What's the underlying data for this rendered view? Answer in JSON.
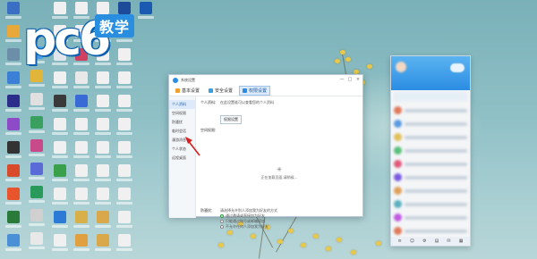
{
  "watermark": {
    "logo": "pc6",
    "badge": "教学"
  },
  "window": {
    "title": "系统设置",
    "controls": [
      "—",
      "□",
      "×"
    ],
    "tabs": [
      {
        "label": "基本设置",
        "icon": "basic-settings-icon",
        "active": false
      },
      {
        "label": "安全设置",
        "icon": "security-settings-icon",
        "active": false
      },
      {
        "label": "权限设置",
        "icon": "permission-settings-icon",
        "active": true
      }
    ],
    "sidebar": [
      {
        "label": "个人资料",
        "active": true
      },
      {
        "label": "空间权限",
        "active": false
      },
      {
        "label": "防骚扰",
        "active": false
      },
      {
        "label": "临时会话",
        "active": false
      },
      {
        "label": "漫游消息",
        "active": false
      },
      {
        "label": "个人状态",
        "active": false
      },
      {
        "label": "远程桌面",
        "active": false
      }
    ],
    "content": {
      "profile_label": "个人资料:",
      "profile_text": "在此设置谁可以查看您的个人资料",
      "profile_button": "权限设置",
      "space_label": "空间权限:",
      "loading_text": "正在加载页面,请稍候…",
      "anti_label": "防骚扰:",
      "anti_desc": "请选择允许别人添加我为好友的方式",
      "options": [
        {
          "label": "通过邀请或直接加为好友",
          "selected": true
        },
        {
          "label": "只能通过账号或邮箱添加",
          "selected": false
        },
        {
          "label": "不允许任何人添加我为好友",
          "selected": false
        }
      ]
    }
  },
  "colors": {
    "accent": "#2b8de3",
    "arrow": "#d62020"
  }
}
